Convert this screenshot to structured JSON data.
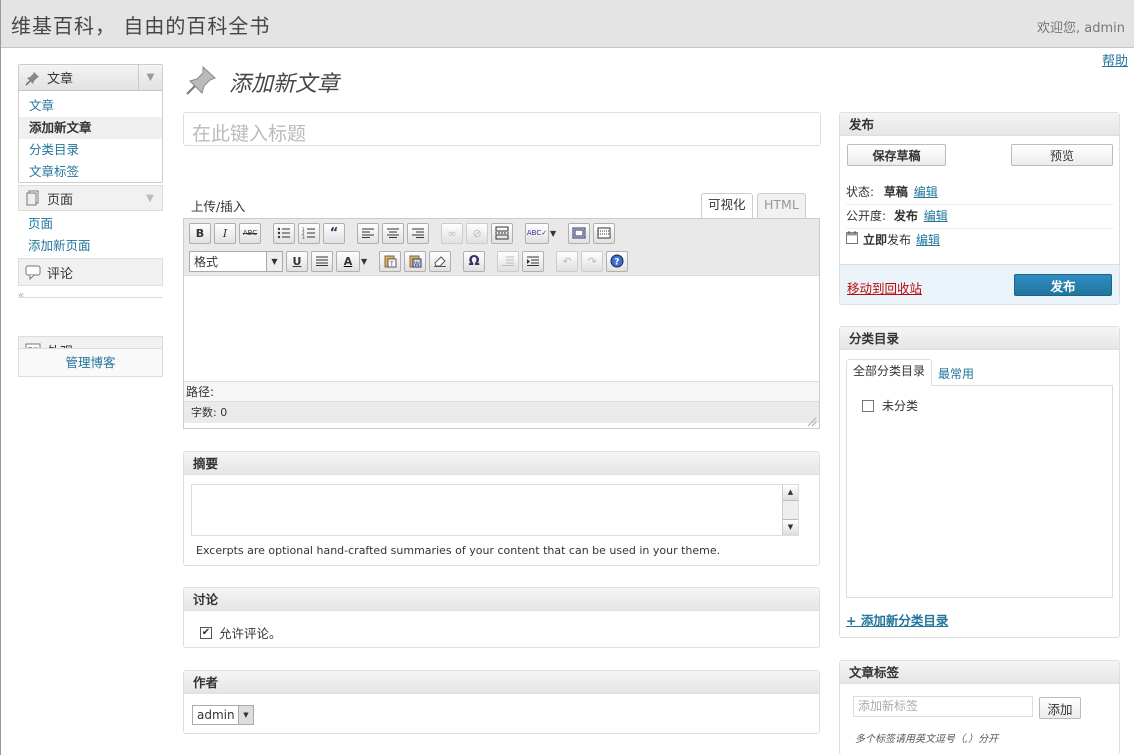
{
  "header": {
    "site_title": "维基百科， 自由的百科全书",
    "greeting": "欢迎您, admin",
    "help": "帮助"
  },
  "sidebar": {
    "posts_menu": {
      "label": "文章",
      "items": [
        "文章",
        "添加新文章",
        "分类目录",
        "文章标签"
      ],
      "current": 1
    },
    "pages_menu": {
      "label": "页面",
      "items": [
        "页面",
        "添加新页面"
      ]
    },
    "comments_label": "评论",
    "appearance_label": "外观",
    "manage_blog": "管理博客",
    "collapse_glyph": "«"
  },
  "main": {
    "heading": "添加新文章",
    "title_placeholder": "在此键入标题",
    "upload_insert": "上传/插入",
    "tab_visual": "可视化",
    "tab_html": "HTML",
    "format_select": "格式",
    "path_label": "路径:",
    "word_count": "字数: 0",
    "excerpt": {
      "title": "摘要",
      "hint": "Excerpts are optional hand-crafted summaries of your content that can be used in your theme."
    },
    "discussion": {
      "title": "讨论",
      "allow_comments": "允许评论。",
      "checked": true
    },
    "author": {
      "title": "作者",
      "value": "admin"
    }
  },
  "publish": {
    "title": "发布",
    "save_draft": "保存草稿",
    "preview": "预览",
    "status_label": "状态:",
    "status_value": "草稿",
    "visibility_label": "公开度:",
    "visibility_value": "发布",
    "schedule_prefix": "立即",
    "schedule_suffix": "发布",
    "edit": "编辑",
    "trash": "移动到回收站",
    "publish_btn": "发布"
  },
  "categories": {
    "title": "分类目录",
    "tab_all": "全部分类目录",
    "tab_popular": "最常用",
    "items": [
      "未分类"
    ],
    "add_new": "+ 添加新分类目录"
  },
  "tags": {
    "title": "文章标签",
    "input_placeholder": "添加新标签",
    "add_btn": "添加",
    "hint": "多个标签请用英文逗号（,）分开"
  },
  "colors": {
    "link": "#21759b",
    "publish_button": "#21759b",
    "trash": "#bc0b0b",
    "header_bg": "#e4e4e4"
  }
}
